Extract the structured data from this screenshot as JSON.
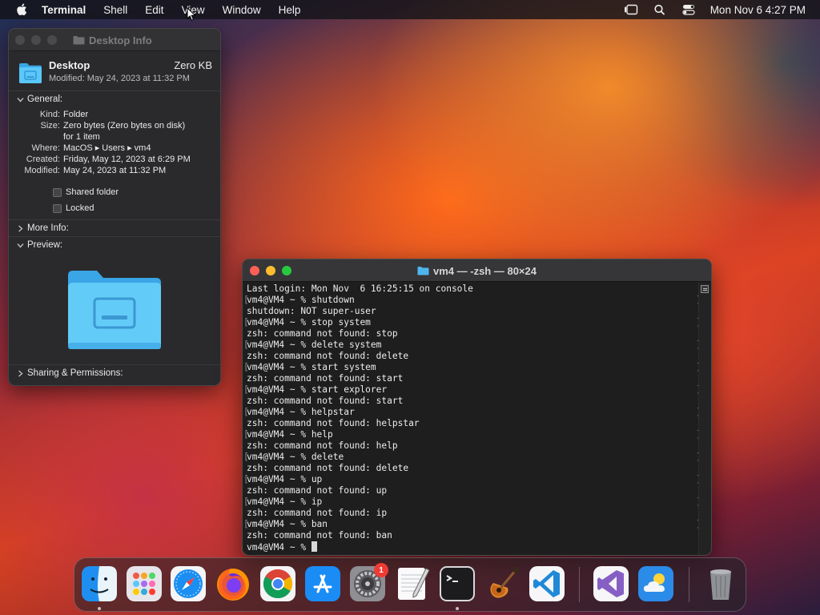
{
  "menubar": {
    "app_name": "Terminal",
    "items": [
      "Shell",
      "Edit",
      "View",
      "Window",
      "Help"
    ],
    "clock": "Mon Nov 6  4:27 PM"
  },
  "info_window": {
    "title": "Desktop Info",
    "name": "Desktop",
    "size": "Zero KB",
    "modified_header": "Modified: May 24, 2023 at 11:32 PM",
    "general": {
      "heading": "General:",
      "rows": [
        {
          "key": "Kind:",
          "value": "Folder"
        },
        {
          "key": "Size:",
          "value": "Zero bytes (Zero bytes on disk)"
        },
        {
          "key": "",
          "value": "for 1 item"
        },
        {
          "key": "Where:",
          "value": "MacOS ▸ Users ▸ vm4"
        },
        {
          "key": "Created:",
          "value": "Friday, May 12, 2023 at 6:29 PM"
        },
        {
          "key": "Modified:",
          "value": "May 24, 2023 at 11:32 PM"
        }
      ],
      "shared_folder_label": "Shared folder",
      "locked_label": "Locked"
    },
    "more_info": "More Info:",
    "preview": "Preview:",
    "sharing": "Sharing & Permissions:"
  },
  "terminal": {
    "title": "vm4 — -zsh — 80×24",
    "lines": [
      {
        "text": "Last login: Mon Nov  6 16:25:15 on console",
        "prompt": false
      },
      {
        "text": "vm4@VM4 ~ % shutdown",
        "prompt": true
      },
      {
        "text": "shutdown: NOT super-user",
        "prompt": false
      },
      {
        "text": "vm4@VM4 ~ % stop system",
        "prompt": true
      },
      {
        "text": "zsh: command not found: stop",
        "prompt": false
      },
      {
        "text": "vm4@VM4 ~ % delete system",
        "prompt": true
      },
      {
        "text": "zsh: command not found: delete",
        "prompt": false
      },
      {
        "text": "vm4@VM4 ~ % start system",
        "prompt": true
      },
      {
        "text": "zsh: command not found: start",
        "prompt": false
      },
      {
        "text": "vm4@VM4 ~ % start explorer",
        "prompt": true
      },
      {
        "text": "zsh: command not found: start",
        "prompt": false
      },
      {
        "text": "vm4@VM4 ~ % helpstar",
        "prompt": true
      },
      {
        "text": "zsh: command not found: helpstar",
        "prompt": false
      },
      {
        "text": "vm4@VM4 ~ % help",
        "prompt": true
      },
      {
        "text": "zsh: command not found: help",
        "prompt": false
      },
      {
        "text": "vm4@VM4 ~ % delete",
        "prompt": true
      },
      {
        "text": "zsh: command not found: delete",
        "prompt": false
      },
      {
        "text": "vm4@VM4 ~ % up",
        "prompt": true
      },
      {
        "text": "zsh: command not found: up",
        "prompt": false
      },
      {
        "text": "vm4@VM4 ~ % ip",
        "prompt": true
      },
      {
        "text": "zsh: command not found: ip",
        "prompt": false
      },
      {
        "text": "vm4@VM4 ~ % ban",
        "prompt": true
      },
      {
        "text": "zsh: command not found: ban",
        "prompt": false
      }
    ],
    "current_prompt": "vm4@VM4 ~ % "
  },
  "dock": {
    "apps": [
      {
        "icon": "finder-icon",
        "running": true
      },
      {
        "icon": "launchpad-icon",
        "running": false
      },
      {
        "icon": "safari-icon",
        "running": false
      },
      {
        "icon": "firefox-icon",
        "running": false
      },
      {
        "icon": "chrome-icon",
        "running": false
      },
      {
        "icon": "app-store-icon",
        "running": false
      },
      {
        "icon": "system-settings-icon",
        "running": false,
        "badge": "1"
      },
      {
        "icon": "textedit-icon",
        "running": false
      },
      {
        "icon": "terminal-icon",
        "running": true
      },
      {
        "icon": "garageband-icon",
        "running": false
      },
      {
        "icon": "vscode-icon",
        "running": false
      },
      {
        "icon": "visual-studio-icon",
        "running": false
      },
      {
        "icon": "weather-icon",
        "running": false
      },
      {
        "icon": "trash-icon",
        "running": false
      }
    ]
  },
  "colors": {
    "terminal_bg": "#1e1e1e",
    "close": "#fe5f57",
    "minimize": "#febc2e",
    "zoom": "#28c840",
    "folder_blue": "#5ac8fa"
  }
}
